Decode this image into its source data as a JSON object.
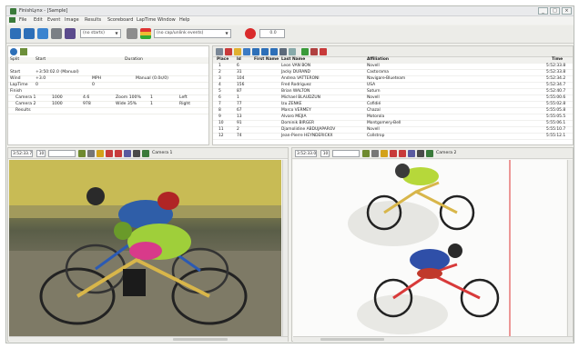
{
  "window": {
    "title": "FinishLynx - [Sample]"
  },
  "menu": [
    "File",
    "Edit",
    "Event",
    "Image",
    "Results",
    "Scoreboard",
    "LapTime",
    "Window",
    "Help"
  ],
  "toolbar": {
    "event_combo": "(no starts)",
    "events_combo": "(no cap/unlink events)",
    "time_value": "0.0"
  },
  "left_panel": {
    "headers": {
      "split": "Split",
      "start": "Start",
      "duration": "Duration"
    },
    "rows": [
      {
        "label": "Start",
        "value": "+3:50:02.0 (Manual)"
      },
      {
        "label": "Wind",
        "value": "+3.0",
        "unit": "MPH",
        "extra": "Manual (0.0s/0)"
      },
      {
        "label": "LapTime",
        "value": "0",
        "extra2": "0"
      },
      {
        "label": "Finish",
        "value": ""
      }
    ],
    "cameras": [
      {
        "name": "Camera 1",
        "c1": "1000",
        "c2": "4.6",
        "c3": "Zoom 100%",
        "c4": "1",
        "c5": "Left"
      },
      {
        "name": "Camera 2",
        "c1": "1000",
        "c2": "978",
        "c3": "Wide 35%",
        "c4": "1",
        "c5": "Right"
      }
    ],
    "results_label": "Results"
  },
  "results": {
    "columns": [
      "Place",
      "Id",
      "First Name",
      "Last Name",
      "Affiliation",
      "Time"
    ],
    "rows": [
      {
        "place": "1",
        "id": "6",
        "last": "Leon VAN BON",
        "aff": "Novell",
        "time": "5:52:33.8"
      },
      {
        "place": "2",
        "id": "31",
        "last": "Jacky DURAND",
        "aff": "Castorama",
        "time": "5:52:33.8"
      },
      {
        "place": "3",
        "id": "104",
        "last": "Andrea VATTERONI",
        "aff": "Navigare-Blueteam",
        "time": "5:52:34.2"
      },
      {
        "place": "4",
        "id": "156",
        "last": "Fred Rodriguez",
        "aff": "USA",
        "time": "5:52:34.7"
      },
      {
        "place": "5",
        "id": "87",
        "last": "Brian WALTON",
        "aff": "Saturn",
        "time": "5:52:40.7"
      },
      {
        "place": "6",
        "id": "1",
        "last": "Michael BLAUDZUN",
        "aff": "Novell",
        "time": "5:55:00.6"
      },
      {
        "place": "7",
        "id": "77",
        "last": "Izu ZENKE",
        "aff": "Cofidié",
        "time": "5:55:02.8"
      },
      {
        "place": "8",
        "id": "67",
        "last": "Marco VERMEY",
        "aff": "Chazal",
        "time": "5:55:05.8"
      },
      {
        "place": "9",
        "id": "13",
        "last": "Alvaro MEJIA",
        "aff": "Motorola",
        "time": "5:55:05.5"
      },
      {
        "place": "10",
        "id": "91",
        "last": "Dominik BIRGER",
        "aff": "Montgomery-Bell",
        "time": "5:55:06.1"
      },
      {
        "place": "11",
        "id": "2",
        "last": "Djamolidine ABDUJAPAROV",
        "aff": "Novell",
        "time": "5:55:10.7"
      },
      {
        "place": "12",
        "id": "74",
        "last": "Jean-Pierre HEYNDERICKX",
        "aff": "Collstrop",
        "time": "5:55:12.1"
      }
    ]
  },
  "video1": {
    "time": "3:52:33.7",
    "field": "10",
    "camera": "Camera 1"
  },
  "video2": {
    "time": "3:52:33.0",
    "field": "10",
    "camera": "Camera 2"
  },
  "colors": {
    "accent": "#3a7a3a",
    "toolbar": "#ecece8"
  }
}
